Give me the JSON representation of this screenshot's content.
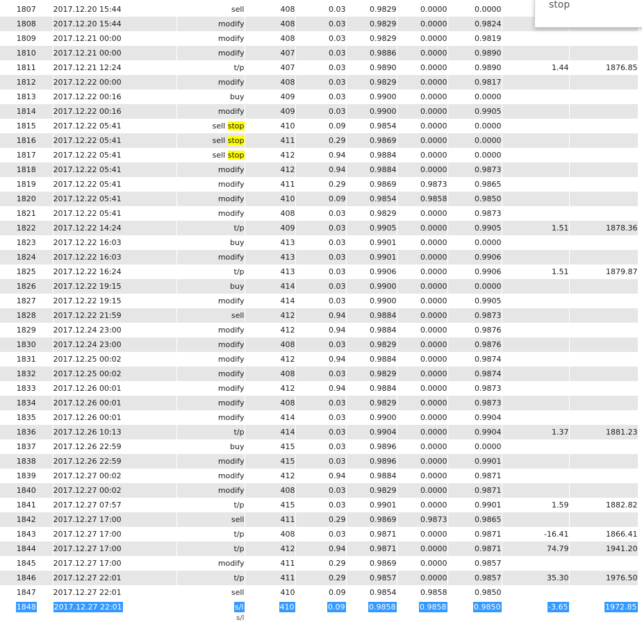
{
  "rows": [
    [
      "1807",
      "2017.12.20 15:44",
      "sell",
      "408",
      "0.03",
      "0.9829",
      "0.0000",
      "0.0000",
      "",
      ""
    ],
    [
      "1808",
      "2017.12.20 15:44",
      "modify",
      "408",
      "0.03",
      "0.9829",
      "0.0000",
      "0.9824",
      "",
      ""
    ],
    [
      "1809",
      "2017.12.21 00:00",
      "modify",
      "408",
      "0.03",
      "0.9829",
      "0.0000",
      "0.9819",
      "",
      ""
    ],
    [
      "1810",
      "2017.12.21 00:00",
      "modify",
      "407",
      "0.03",
      "0.9886",
      "0.0000",
      "0.9890",
      "",
      ""
    ],
    [
      "1811",
      "2017.12.21 12:24",
      "t/p",
      "407",
      "0.03",
      "0.9890",
      "0.0000",
      "0.9890",
      "1.44",
      "1876.85"
    ],
    [
      "1812",
      "2017.12.22 00:00",
      "modify",
      "408",
      "0.03",
      "0.9829",
      "0.0000",
      "0.9817",
      "",
      ""
    ],
    [
      "1813",
      "2017.12.22 00:16",
      "buy",
      "409",
      "0.03",
      "0.9900",
      "0.0000",
      "0.0000",
      "",
      ""
    ],
    [
      "1814",
      "2017.12.22 00:16",
      "modify",
      "409",
      "0.03",
      "0.9900",
      "0.0000",
      "0.9905",
      "",
      ""
    ],
    [
      "1815",
      "2017.12.22 05:41",
      "sell stop",
      "410",
      "0.09",
      "0.9854",
      "0.0000",
      "0.0000",
      "",
      ""
    ],
    [
      "1816",
      "2017.12.22 05:41",
      "sell stop",
      "411",
      "0.29",
      "0.9869",
      "0.0000",
      "0.0000",
      "",
      ""
    ],
    [
      "1817",
      "2017.12.22 05:41",
      "sell stop",
      "412",
      "0.94",
      "0.9884",
      "0.0000",
      "0.0000",
      "",
      ""
    ],
    [
      "1818",
      "2017.12.22 05:41",
      "modify",
      "412",
      "0.94",
      "0.9884",
      "0.0000",
      "0.9873",
      "",
      ""
    ],
    [
      "1819",
      "2017.12.22 05:41",
      "modify",
      "411",
      "0.29",
      "0.9869",
      "0.9873",
      "0.9865",
      "",
      ""
    ],
    [
      "1820",
      "2017.12.22 05:41",
      "modify",
      "410",
      "0.09",
      "0.9854",
      "0.9858",
      "0.9850",
      "",
      ""
    ],
    [
      "1821",
      "2017.12.22 05:41",
      "modify",
      "408",
      "0.03",
      "0.9829",
      "0.0000",
      "0.9873",
      "",
      ""
    ],
    [
      "1822",
      "2017.12.22 14:24",
      "t/p",
      "409",
      "0.03",
      "0.9905",
      "0.0000",
      "0.9905",
      "1.51",
      "1878.36"
    ],
    [
      "1823",
      "2017.12.22 16:03",
      "buy",
      "413",
      "0.03",
      "0.9901",
      "0.0000",
      "0.0000",
      "",
      ""
    ],
    [
      "1824",
      "2017.12.22 16:03",
      "modify",
      "413",
      "0.03",
      "0.9901",
      "0.0000",
      "0.9906",
      "",
      ""
    ],
    [
      "1825",
      "2017.12.22 16:24",
      "t/p",
      "413",
      "0.03",
      "0.9906",
      "0.0000",
      "0.9906",
      "1.51",
      "1879.87"
    ],
    [
      "1826",
      "2017.12.22 19:15",
      "buy",
      "414",
      "0.03",
      "0.9900",
      "0.0000",
      "0.0000",
      "",
      ""
    ],
    [
      "1827",
      "2017.12.22 19:15",
      "modify",
      "414",
      "0.03",
      "0.9900",
      "0.0000",
      "0.9905",
      "",
      ""
    ],
    [
      "1828",
      "2017.12.22 21:59",
      "sell",
      "412",
      "0.94",
      "0.9884",
      "0.0000",
      "0.9873",
      "",
      ""
    ],
    [
      "1829",
      "2017.12.24 23:00",
      "modify",
      "412",
      "0.94",
      "0.9884",
      "0.0000",
      "0.9876",
      "",
      ""
    ],
    [
      "1830",
      "2017.12.24 23:00",
      "modify",
      "408",
      "0.03",
      "0.9829",
      "0.0000",
      "0.9876",
      "",
      ""
    ],
    [
      "1831",
      "2017.12.25 00:02",
      "modify",
      "412",
      "0.94",
      "0.9884",
      "0.0000",
      "0.9874",
      "",
      ""
    ],
    [
      "1832",
      "2017.12.25 00:02",
      "modify",
      "408",
      "0.03",
      "0.9829",
      "0.0000",
      "0.9874",
      "",
      ""
    ],
    [
      "1833",
      "2017.12.26 00:01",
      "modify",
      "412",
      "0.94",
      "0.9884",
      "0.0000",
      "0.9873",
      "",
      ""
    ],
    [
      "1834",
      "2017.12.26 00:01",
      "modify",
      "408",
      "0.03",
      "0.9829",
      "0.0000",
      "0.9873",
      "",
      ""
    ],
    [
      "1835",
      "2017.12.26 00:01",
      "modify",
      "414",
      "0.03",
      "0.9900",
      "0.0000",
      "0.9904",
      "",
      ""
    ],
    [
      "1836",
      "2017.12.26 10:13",
      "t/p",
      "414",
      "0.03",
      "0.9904",
      "0.0000",
      "0.9904",
      "1.37",
      "1881.23"
    ],
    [
      "1837",
      "2017.12.26 22:59",
      "buy",
      "415",
      "0.03",
      "0.9896",
      "0.0000",
      "0.0000",
      "",
      ""
    ],
    [
      "1838",
      "2017.12.26 22:59",
      "modify",
      "415",
      "0.03",
      "0.9896",
      "0.0000",
      "0.9901",
      "",
      ""
    ],
    [
      "1839",
      "2017.12.27 00:02",
      "modify",
      "412",
      "0.94",
      "0.9884",
      "0.0000",
      "0.9871",
      "",
      ""
    ],
    [
      "1840",
      "2017.12.27 00:02",
      "modify",
      "408",
      "0.03",
      "0.9829",
      "0.0000",
      "0.9871",
      "",
      ""
    ],
    [
      "1841",
      "2017.12.27 07:57",
      "t/p",
      "415",
      "0.03",
      "0.9901",
      "0.0000",
      "0.9901",
      "1.59",
      "1882.82"
    ],
    [
      "1842",
      "2017.12.27 17:00",
      "sell",
      "411",
      "0.29",
      "0.9869",
      "0.9873",
      "0.9865",
      "",
      ""
    ],
    [
      "1843",
      "2017.12.27 17:00",
      "t/p",
      "408",
      "0.03",
      "0.9871",
      "0.0000",
      "0.9871",
      "-16.41",
      "1866.41"
    ],
    [
      "1844",
      "2017.12.27 17:00",
      "t/p",
      "412",
      "0.94",
      "0.9871",
      "0.0000",
      "0.9871",
      "74.79",
      "1941.20"
    ],
    [
      "1845",
      "2017.12.27 17:00",
      "modify",
      "411",
      "0.29",
      "0.9869",
      "0.0000",
      "0.9857",
      "",
      ""
    ],
    [
      "1846",
      "2017.12.27 22:01",
      "t/p",
      "411",
      "0.29",
      "0.9857",
      "0.0000",
      "0.9857",
      "35.30",
      "1976.50"
    ],
    [
      "1847",
      "2017.12.27 22:01",
      "sell",
      "410",
      "0.09",
      "0.9854",
      "0.9858",
      "0.9850",
      "",
      ""
    ],
    [
      "1848",
      "2017.12.27 22:01",
      "s/l",
      "410",
      "0.09",
      "0.9858",
      "0.9858",
      "0.9850",
      "-3.65",
      "1972.85"
    ]
  ],
  "highlight_word": "stop",
  "selected_row_index": 41,
  "popup_text": "stop",
  "cut_row_text": "s/l",
  "colors": {
    "stripe": "#e6e6e6",
    "highlight": "#ffff00",
    "selection": "#3399ff"
  }
}
